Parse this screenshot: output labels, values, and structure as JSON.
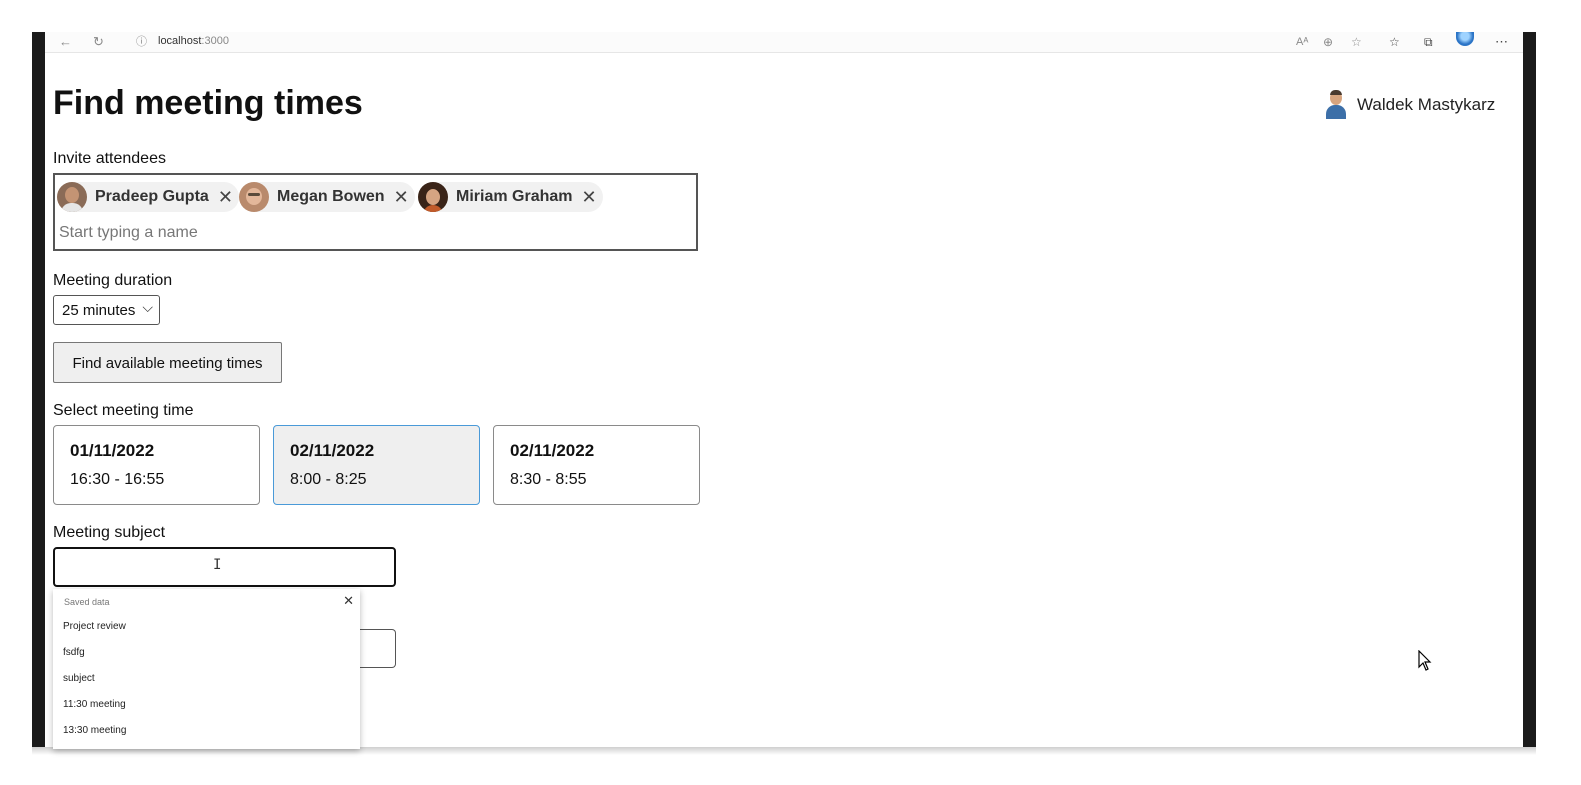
{
  "browser": {
    "url_host": "localhost",
    "url_port": ":3000",
    "icons": [
      "back-icon",
      "refresh-icon",
      "info-icon",
      "read-aloud-icon",
      "zoom-icon",
      "favorite-add-icon",
      "favorites-icon",
      "collections-icon",
      "profile-icon",
      "more-icon"
    ]
  },
  "header": {
    "title": "Find meeting times",
    "user_name": "Waldek Mastykarz"
  },
  "attendees": {
    "label": "Invite attendees",
    "chips": [
      {
        "name": "Pradeep Gupta"
      },
      {
        "name": "Megan Bowen"
      },
      {
        "name": "Miriam Graham"
      }
    ],
    "placeholder": "Start typing a name"
  },
  "duration": {
    "label": "Meeting duration",
    "value": "25 minutes"
  },
  "find_button": {
    "label": "Find available meeting times"
  },
  "slots": {
    "label": "Select meeting time",
    "items": [
      {
        "date": "01/11/2022",
        "time": "16:30 - 16:55",
        "selected": false
      },
      {
        "date": "02/11/2022",
        "time": "8:00 - 8:25",
        "selected": true
      },
      {
        "date": "02/11/2022",
        "time": "8:30 - 8:55",
        "selected": false
      }
    ]
  },
  "subject": {
    "label": "Meeting subject",
    "value": ""
  },
  "autocomplete": {
    "header": "Saved data",
    "items": [
      "Project review",
      "fsdfg",
      "subject",
      "11:30 meeting",
      "13:30 meeting"
    ]
  },
  "colors": {
    "selected_border": "#4a9ad8",
    "selected_background": "#efefef",
    "chip_background": "#f1f1f1"
  }
}
